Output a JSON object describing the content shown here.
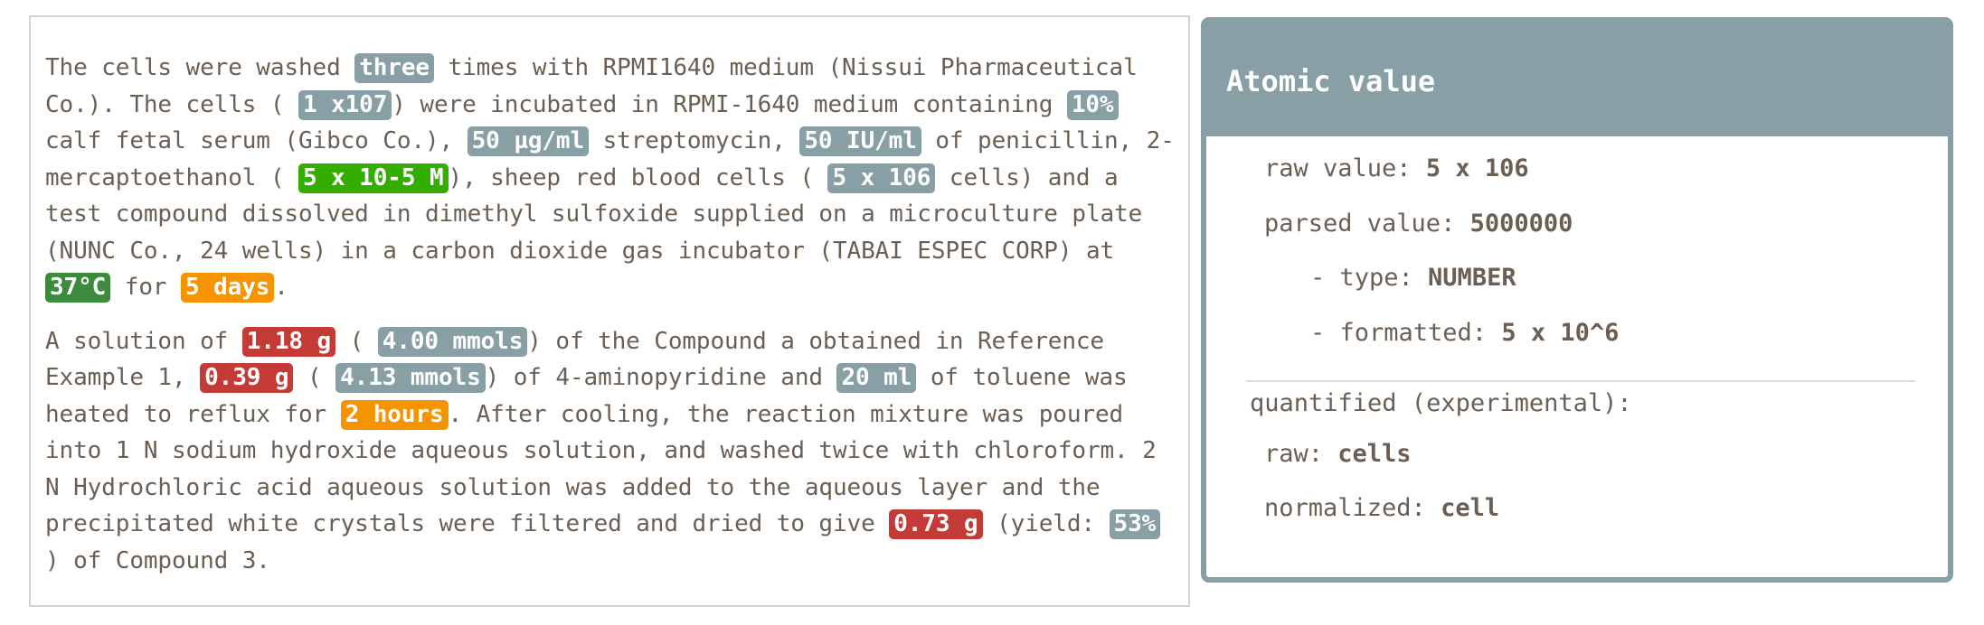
{
  "document": {
    "paragraphs": [
      {
        "segments": [
          {
            "text": "The cells were washed "
          },
          {
            "text": "three",
            "tag": "count"
          },
          {
            "text": " times with RPMI1640 medium (Nissui Pharmaceutical Co.). The cells ( "
          },
          {
            "text": "1 x107",
            "tag": "count"
          },
          {
            "text": ") were incubated in RPMI-1640 medium containing "
          },
          {
            "text": "10%",
            "tag": "count"
          },
          {
            "text": " calf fetal serum (Gibco Co.), "
          },
          {
            "text": "50 µg/ml",
            "tag": "count"
          },
          {
            "text": " streptomycin, "
          },
          {
            "text": "50 IU/ml",
            "tag": "count"
          },
          {
            "text": " of penicillin, 2-mercaptoethanol ( "
          },
          {
            "text": "5 x 10-5 M",
            "tag": "conc"
          },
          {
            "text": "), sheep red blood cells ( "
          },
          {
            "text": "5 x 106",
            "tag": "count"
          },
          {
            "text": " cells) and a test compound dissolved in dimethyl sulfoxide supplied on a microculture plate (NUNC Co., 24 wells) in a carbon dioxide gas incubator (TABAI ESPEC CORP) at "
          },
          {
            "text": "37°C",
            "tag": "temp"
          },
          {
            "text": " for "
          },
          {
            "text": "5 days",
            "tag": "time"
          },
          {
            "text": "."
          }
        ]
      },
      {
        "segments": [
          {
            "text": "A solution of "
          },
          {
            "text": "1.18 g",
            "tag": "mass"
          },
          {
            "text": " ( "
          },
          {
            "text": "4.00 mmols",
            "tag": "count"
          },
          {
            "text": ") of the Compound a obtained in Reference Example 1, "
          },
          {
            "text": "0.39 g",
            "tag": "mass"
          },
          {
            "text": " ( "
          },
          {
            "text": "4.13 mmols",
            "tag": "count"
          },
          {
            "text": ") of 4-aminopyridine and "
          },
          {
            "text": "20 ml",
            "tag": "count"
          },
          {
            "text": " of toluene was heated to reflux for "
          },
          {
            "text": "2 hours",
            "tag": "time"
          },
          {
            "text": ". After cooling, the reaction mixture was poured into 1 N sodium hydroxide aqueous solution, and washed twice with chloroform. 2 N Hydrochloric acid aqueous solution was added to the aqueous layer and the precipitated white crystals were filtered and dried to give "
          },
          {
            "text": "0.73 g",
            "tag": "mass"
          },
          {
            "text": " (yield: "
          },
          {
            "text": "53%",
            "tag": "count"
          },
          {
            "text": " ) of Compound 3."
          }
        ]
      }
    ],
    "tag_colors": {
      "count": "#879fa5",
      "conc": "#33ad00",
      "temp": "#3c8a3c",
      "time": "#f59300",
      "mass": "#c33a36"
    }
  },
  "panel": {
    "title": "Atomic value",
    "raw_value_label": "raw value: ",
    "raw_value": "5 x 106",
    "parsed_value_label": "parsed value: ",
    "parsed_value": "5000000",
    "type_label": "- type: ",
    "type": "NUMBER",
    "formatted_label": "- formatted: ",
    "formatted": "5 x 10^6",
    "quantified_label": "quantified (experimental):",
    "q_raw_label": "raw: ",
    "q_raw": "cells",
    "q_normalized_label": "normalized: ",
    "q_normalized": "cell"
  }
}
